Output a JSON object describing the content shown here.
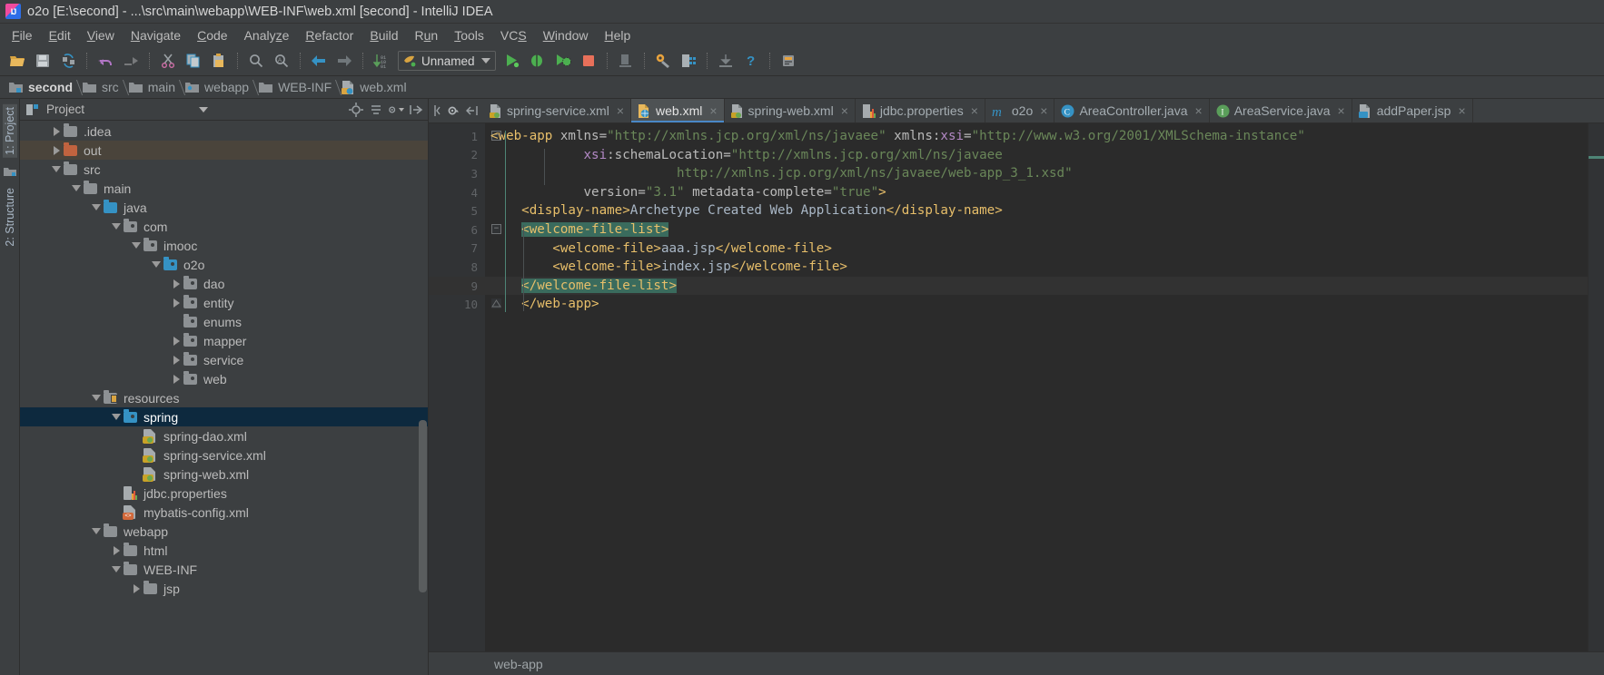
{
  "window": {
    "title": "o2o [E:\\second] - ...\\src\\main\\webapp\\WEB-INF\\web.xml [second] - IntelliJ IDEA",
    "app_icon": "intellij-idea-icon"
  },
  "menubar": {
    "items": [
      {
        "label": "File",
        "mnemonic": "F"
      },
      {
        "label": "Edit",
        "mnemonic": "E"
      },
      {
        "label": "View",
        "mnemonic": "V"
      },
      {
        "label": "Navigate",
        "mnemonic": "N"
      },
      {
        "label": "Code",
        "mnemonic": "C"
      },
      {
        "label": "Analyze",
        "mnemonic": "z"
      },
      {
        "label": "Refactor",
        "mnemonic": "R"
      },
      {
        "label": "Build",
        "mnemonic": "B"
      },
      {
        "label": "Run",
        "mnemonic": "u"
      },
      {
        "label": "Tools",
        "mnemonic": "T"
      },
      {
        "label": "VCS",
        "mnemonic": "S"
      },
      {
        "label": "Window",
        "mnemonic": "W"
      },
      {
        "label": "Help",
        "mnemonic": "H"
      }
    ]
  },
  "toolbar": {
    "buttons": [
      "open-folder-icon",
      "save-all-icon",
      "sync-refresh-icon",
      "undo-icon",
      "redo-icon",
      "cut-icon",
      "copy-icon",
      "paste-icon",
      "find-icon",
      "replace-icon",
      "back-icon",
      "forward-icon",
      "sort-icon"
    ],
    "run_config": {
      "name": "Unnamed",
      "icon": "tomcat-icon"
    },
    "run_buttons": [
      "run-icon",
      "debug-icon",
      "run-coverage-icon",
      "stop-icon",
      "apply-changes-icon",
      "settings-icon",
      "project-structure-icon",
      "update-project-icon",
      "help-icon",
      "search-everywhere-icon"
    ]
  },
  "breadcrumb": {
    "items": [
      {
        "label": "second",
        "icon": "module-folder-icon"
      },
      {
        "label": "src",
        "icon": "folder-icon"
      },
      {
        "label": "main",
        "icon": "folder-icon"
      },
      {
        "label": "webapp",
        "icon": "source-folder-icon"
      },
      {
        "label": "WEB-INF",
        "icon": "folder-icon"
      },
      {
        "label": "web.xml",
        "icon": "web-xml-icon"
      }
    ]
  },
  "left_tool_strip": {
    "items": [
      {
        "label": "1: Project",
        "active": true
      },
      {
        "label": "2: Structure",
        "active": false
      }
    ]
  },
  "project_panel": {
    "title": "Project",
    "title_icon": "project-view-icon",
    "header_buttons": [
      "locate-target-icon",
      "collapse-all-icon",
      "settings-gear-icon",
      "hide-icon"
    ],
    "tree": [
      {
        "label": ".idea",
        "depth": 1,
        "state": "collapsed",
        "icon": "folder-grey",
        "selected": "none"
      },
      {
        "label": "out",
        "depth": 1,
        "state": "collapsed",
        "icon": "folder-orange",
        "selected": "out"
      },
      {
        "label": "src",
        "depth": 1,
        "state": "expanded",
        "icon": "folder-grey",
        "selected": "none"
      },
      {
        "label": "main",
        "depth": 2,
        "state": "expanded",
        "icon": "folder-grey",
        "selected": "none"
      },
      {
        "label": "java",
        "depth": 3,
        "state": "expanded",
        "icon": "folder-blue",
        "selected": "none"
      },
      {
        "label": "com",
        "depth": 4,
        "state": "expanded",
        "icon": "package-grey",
        "selected": "none"
      },
      {
        "label": "imooc",
        "depth": 5,
        "state": "expanded",
        "icon": "package-grey",
        "selected": "none"
      },
      {
        "label": "o2o",
        "depth": 6,
        "state": "expanded",
        "icon": "package-blue",
        "selected": "none"
      },
      {
        "label": "dao",
        "depth": 7,
        "state": "collapsed",
        "icon": "package-grey",
        "selected": "none"
      },
      {
        "label": "entity",
        "depth": 7,
        "state": "collapsed",
        "icon": "package-grey",
        "selected": "none"
      },
      {
        "label": "enums",
        "depth": 7,
        "state": "leaf",
        "icon": "package-grey",
        "selected": "none"
      },
      {
        "label": "mapper",
        "depth": 7,
        "state": "collapsed",
        "icon": "package-grey",
        "selected": "none"
      },
      {
        "label": "service",
        "depth": 7,
        "state": "collapsed",
        "icon": "package-grey",
        "selected": "none"
      },
      {
        "label": "web",
        "depth": 7,
        "state": "collapsed",
        "icon": "package-grey",
        "selected": "none"
      },
      {
        "label": "resources",
        "depth": 3,
        "state": "expanded",
        "icon": "folder-resources",
        "selected": "none"
      },
      {
        "label": "spring",
        "depth": 4,
        "state": "expanded",
        "icon": "package-blue",
        "selected": "spring"
      },
      {
        "label": "spring-dao.xml",
        "depth": 5,
        "state": "file",
        "icon": "xml-spring-icon",
        "selected": "none"
      },
      {
        "label": "spring-service.xml",
        "depth": 5,
        "state": "file",
        "icon": "xml-spring-icon",
        "selected": "none"
      },
      {
        "label": "spring-web.xml",
        "depth": 5,
        "state": "file",
        "icon": "xml-spring-icon",
        "selected": "none"
      },
      {
        "label": "jdbc.properties",
        "depth": 4,
        "state": "file",
        "icon": "properties-icon",
        "selected": "none"
      },
      {
        "label": "mybatis-config.xml",
        "depth": 4,
        "state": "file",
        "icon": "xml-orange-icon",
        "selected": "none"
      },
      {
        "label": "webapp",
        "depth": 3,
        "state": "expanded",
        "icon": "folder-grey",
        "selected": "none"
      },
      {
        "label": "html",
        "depth": 4,
        "state": "collapsed",
        "icon": "folder-grey",
        "selected": "none"
      },
      {
        "label": "WEB-INF",
        "depth": 4,
        "state": "expanded",
        "icon": "folder-grey",
        "selected": "none"
      },
      {
        "label": "jsp",
        "depth": 5,
        "state": "collapsed",
        "icon": "folder-grey",
        "selected": "none"
      }
    ]
  },
  "editor_tabs": {
    "lead_buttons": [
      "back-nav-icon",
      "settings-gear-icon",
      "hide-tabs-icon"
    ],
    "tabs": [
      {
        "label": "spring-service.xml",
        "icon": "xml-spring-icon",
        "active": false,
        "closable": true
      },
      {
        "label": "web.xml",
        "icon": "web-xml-icon",
        "active": true,
        "closable": true
      },
      {
        "label": "spring-web.xml",
        "icon": "xml-spring-icon",
        "active": false,
        "closable": true
      },
      {
        "label": "jdbc.properties",
        "icon": "properties-icon",
        "active": false,
        "closable": true
      },
      {
        "label": "o2o",
        "icon": "maven-module-icon",
        "active": false,
        "closable": true
      },
      {
        "label": "AreaController.java",
        "icon": "java-class-icon",
        "active": false,
        "closable": true
      },
      {
        "label": "AreaService.java",
        "icon": "java-interface-icon",
        "active": false,
        "closable": true
      },
      {
        "label": "addPaper.jsp",
        "icon": "jsp-icon",
        "active": false,
        "closable": true
      }
    ]
  },
  "code": {
    "language": "xml",
    "lines": [
      {
        "num": "1",
        "highlight": false,
        "fold": "collapse-marker"
      },
      {
        "num": "2",
        "highlight": false,
        "fold": ""
      },
      {
        "num": "3",
        "highlight": false,
        "fold": ""
      },
      {
        "num": "4",
        "highlight": false,
        "fold": ""
      },
      {
        "num": "5",
        "highlight": false,
        "fold": ""
      },
      {
        "num": "6",
        "highlight": false,
        "fold": "collapse-marker"
      },
      {
        "num": "7",
        "highlight": false,
        "fold": ""
      },
      {
        "num": "8",
        "highlight": false,
        "fold": ""
      },
      {
        "num": "9",
        "highlight": true,
        "fold": "collapse-end"
      },
      {
        "num": "10",
        "highlight": false,
        "fold": "collapse-end"
      }
    ],
    "text": {
      "l1_a": "<web-app ",
      "l1_b": "xmlns=",
      "l1_c": "\"http://xmlns.jcp.org/xml/ns/javaee\"",
      "l1_d": " xmlns:",
      "l1_e": "xsi",
      "l1_f": "=",
      "l1_g": "\"http://www.w3.org/2001/XMLSchema-instance\"",
      "l2_a": "xsi",
      "l2_b": ":schemaLocation=",
      "l2_c": "\"http://xmlns.jcp.org/xml/ns/javaee",
      "l3_a": "http://xmlns.jcp.org/xml/ns/javaee/web-app_3_1.xsd\"",
      "l4_a": "version=",
      "l4_b": "\"3.1\"",
      "l4_c": " metadata-complete=",
      "l4_d": "\"true\"",
      "l4_e": ">",
      "l5_a": "<display-name>",
      "l5_b": "Archetype Created Web Application",
      "l5_c": "</display-name>",
      "l6_a": "<welcome-file-list>",
      "l7_a": "<welcome-file>",
      "l7_b": "aaa.jsp",
      "l7_c": "</welcome-file>",
      "l8_a": "<welcome-file>",
      "l8_b": "index.jsp",
      "l8_c": "</welcome-file>",
      "l9_a": "</welcome-file-list>",
      "l10_a": "</web-app>"
    }
  },
  "editor_footer": {
    "path": "web-app"
  },
  "colors": {
    "bg_chrome": "#3c3f41",
    "bg_editor": "#2b2b2b",
    "gutter": "#313335",
    "accent_tab": "#4a88c7",
    "selection_tree": "#0d293e",
    "selection_code": "#3a6b5d",
    "text_primary": "#bbbbbb",
    "xml_tag": "#e8bf6a",
    "xml_string": "#6a8759",
    "xml_ns": "#b389c5"
  }
}
